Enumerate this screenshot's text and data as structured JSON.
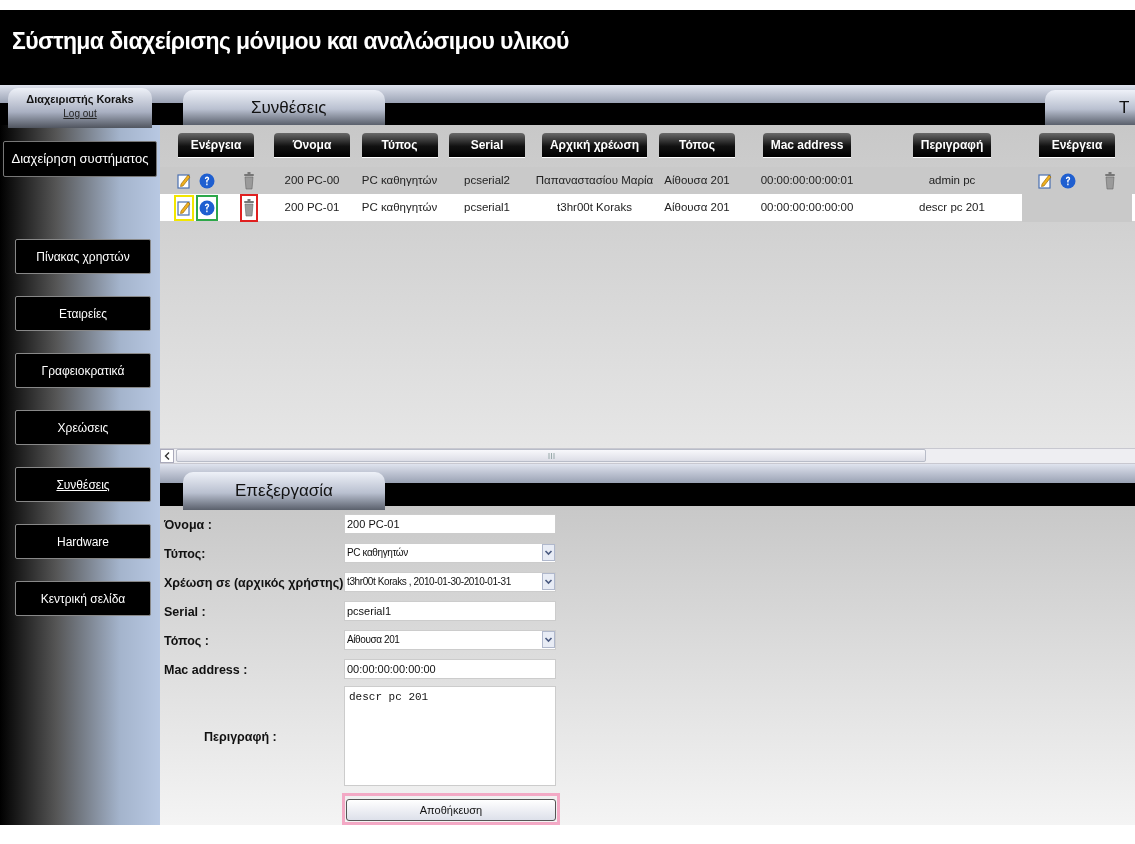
{
  "page": {
    "title": "Σύστημα διαχείρισης μόνιμου και αναλώσιμου υλικού"
  },
  "user": {
    "name": "Διαχειριστής Koraks",
    "logout": "Log out"
  },
  "tabs": [
    {
      "label": "Συνθέσεις"
    },
    {
      "label": "Τ"
    }
  ],
  "sidebar": {
    "heading": "Διαχείρηση συστήματος",
    "items": [
      {
        "label": "Πίνακας χρηστών",
        "selected": false
      },
      {
        "label": "Εταιρείες",
        "selected": false
      },
      {
        "label": "Γραφειοκρατικά",
        "selected": false
      },
      {
        "label": "Χρεώσεις",
        "selected": false
      },
      {
        "label": "Συνθέσεις",
        "selected": true
      },
      {
        "label": "Hardware",
        "selected": false
      },
      {
        "label": "Κεντρική σελίδα",
        "selected": false
      }
    ]
  },
  "table": {
    "columns": [
      "Ενέργεια",
      "Όνομα",
      "Τύπος",
      "Serial",
      "Αρχική χρέωση",
      "Τόπος",
      "Mac address",
      "Περιγραφή",
      "Ενέργεια"
    ],
    "rows": [
      {
        "shaded": true,
        "cells": [
          {
            "kind": "actions",
            "actions": [
              {
                "kind": "edit"
              },
              {
                "kind": "info"
              },
              {
                "kind": "delete"
              }
            ]
          },
          "200 PC-00",
          "PC καθηγητών",
          "pcserial2",
          "Παπαναστασίου Μαρία",
          "Αίθουσα 201",
          "00:00:00:00:00:01",
          "admin pc",
          {
            "kind": "actions",
            "actions": [
              {
                "kind": "edit"
              },
              {
                "kind": "info"
              },
              {
                "kind": "delete"
              }
            ]
          }
        ]
      },
      {
        "shaded": false,
        "cells": [
          {
            "kind": "actions",
            "actions": [
              {
                "kind": "edit",
                "color": "#f2e600"
              },
              {
                "kind": "info",
                "color": "#2ea84a"
              },
              {
                "kind": "delete",
                "color": "#e02020"
              }
            ]
          },
          "200 PC-01",
          "PC καθηγητών",
          "pcserial1",
          "t3hr00t Koraks",
          "Αίθουσα 201",
          "00:00:00:00:00:00",
          "descr pc 201",
          ""
        ]
      }
    ]
  },
  "edit_panel": {
    "tab": "Επεξεργασία",
    "fields": [
      {
        "kind": "text",
        "label": "Όνομα :",
        "value": "200 PC-01"
      },
      {
        "kind": "select",
        "label": "Τύπος:",
        "value": "PC καθηγητών"
      },
      {
        "kind": "select",
        "label": "Χρέωση σε (αρχικός χρήστης):",
        "value": "t3hr00t Koraks , 2010-01-30-2010-01-31"
      },
      {
        "kind": "text",
        "label": "Serial :",
        "value": "pcserial1"
      },
      {
        "kind": "select",
        "label": "Τόπος :",
        "value": "Αίθουσα 201"
      },
      {
        "kind": "text",
        "label": "Mac address :",
        "value": "00:00:00:00:00:00"
      },
      {
        "kind": "textarea",
        "label": "Περιγραφή :",
        "value": "descr pc 201"
      }
    ],
    "save_button": {
      "label": "Αποθήκευση",
      "color": "#f3a9c5"
    }
  }
}
